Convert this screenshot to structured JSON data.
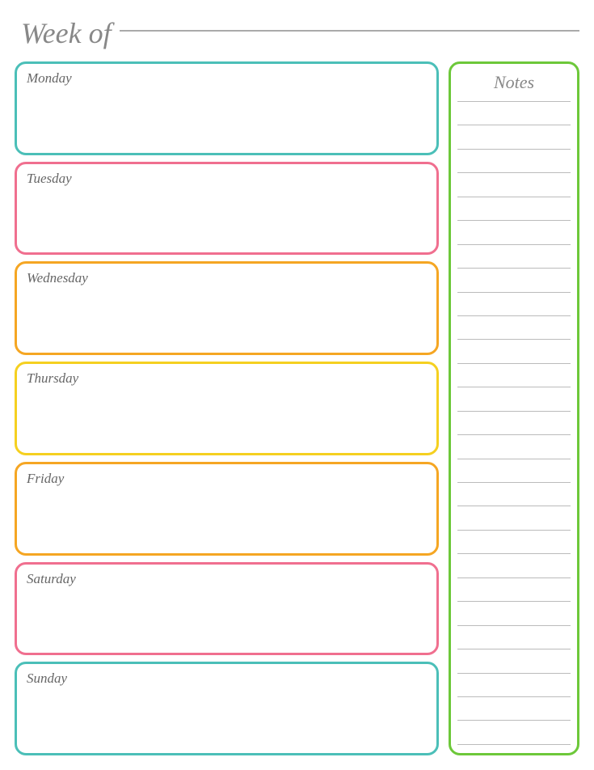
{
  "header": {
    "week_of_label": "Week of",
    "line_placeholder": ""
  },
  "days": [
    {
      "id": "monday",
      "label": "Monday",
      "color_class": "monday"
    },
    {
      "id": "tuesday",
      "label": "Tuesday",
      "color_class": "tuesday"
    },
    {
      "id": "wednesday",
      "label": "Wednesday",
      "color_class": "wednesday"
    },
    {
      "id": "thursday",
      "label": "Thursday",
      "color_class": "thursday"
    },
    {
      "id": "friday",
      "label": "Friday",
      "color_class": "friday"
    },
    {
      "id": "saturday",
      "label": "Saturday",
      "color_class": "saturday"
    },
    {
      "id": "sunday",
      "label": "Sunday",
      "color_class": "sunday"
    }
  ],
  "notes": {
    "title": "Notes",
    "line_count": 28
  }
}
